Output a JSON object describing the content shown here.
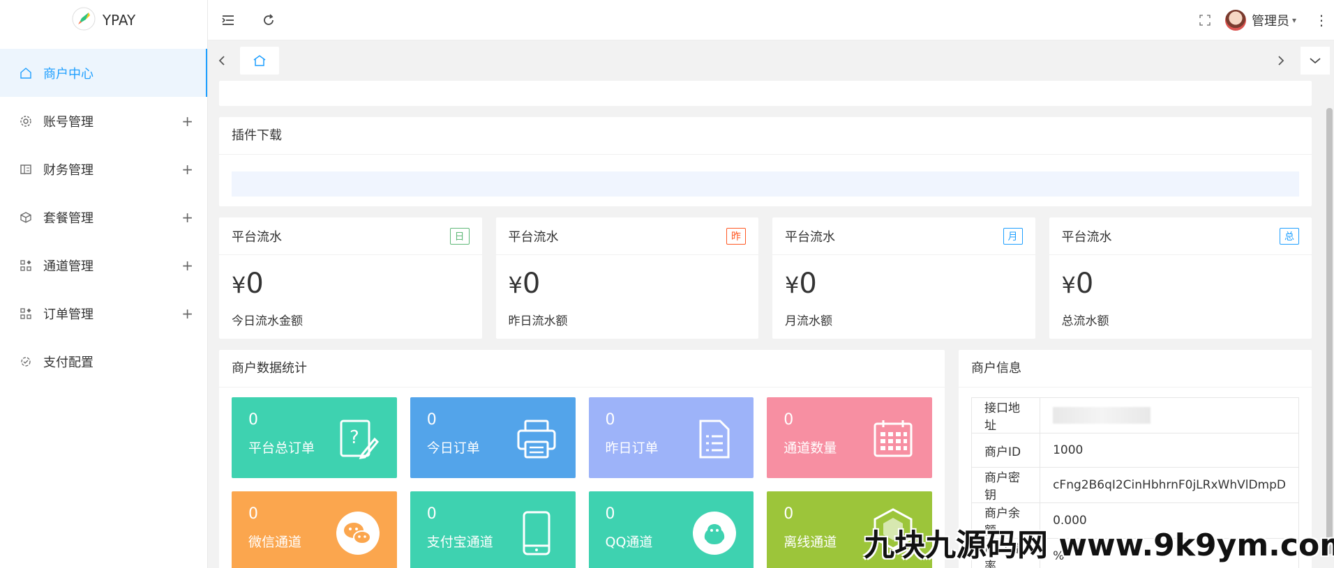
{
  "app": {
    "logo_text": "YPAY"
  },
  "sidebar": {
    "items": [
      {
        "label": "商户中心",
        "icon": "home-icon",
        "active": true,
        "expandable": false
      },
      {
        "label": "账号管理",
        "icon": "gear-icon",
        "expandable": true
      },
      {
        "label": "财务管理",
        "icon": "ledger-icon",
        "expandable": true
      },
      {
        "label": "套餐管理",
        "icon": "cube-icon",
        "expandable": true
      },
      {
        "label": "通道管理",
        "icon": "apps-icon",
        "expandable": true
      },
      {
        "label": "订单管理",
        "icon": "apps-icon",
        "expandable": true
      },
      {
        "label": "支付配置",
        "icon": "config-icon",
        "expandable": false
      }
    ],
    "plus": "+"
  },
  "header": {
    "admin_name": "管理员",
    "caret": "▾",
    "menu": "⋮"
  },
  "plugin": {
    "title": "插件下载"
  },
  "stats": [
    {
      "title": "平台流水",
      "tag": "日",
      "tag_color": "#5fb878",
      "currency": "¥",
      "value": "0",
      "desc": "今日流水金额"
    },
    {
      "title": "平台流水",
      "tag": "昨",
      "tag_color": "#ff5722",
      "currency": "¥",
      "value": "0",
      "desc": "昨日流水额"
    },
    {
      "title": "平台流水",
      "tag": "月",
      "tag_color": "#1e9fff",
      "currency": "¥",
      "value": "0",
      "desc": "月流水额"
    },
    {
      "title": "平台流水",
      "tag": "总",
      "tag_color": "#1e9fff",
      "currency": "¥",
      "value": "0",
      "desc": "总流水额"
    }
  ],
  "merchant_stats": {
    "title": "商户数据统计",
    "tiles": [
      {
        "count": "0",
        "label": "平台总订单",
        "color": "#3ed2b0",
        "icon": "edit-doc-icon"
      },
      {
        "count": "0",
        "label": "今日订单",
        "color": "#53a4ea",
        "icon": "printer-icon"
      },
      {
        "count": "0",
        "label": "昨日订单",
        "color": "#9db3f9",
        "icon": "document-icon"
      },
      {
        "count": "0",
        "label": "通道数量",
        "color": "#f78fa2",
        "icon": "calendar-icon"
      },
      {
        "count": "0",
        "label": "微信通道",
        "color": "#fba64e",
        "icon": "wechat-icon"
      },
      {
        "count": "0",
        "label": "支付宝通道",
        "color": "#3ed2b0",
        "icon": "phone-icon"
      },
      {
        "count": "0",
        "label": "QQ通道",
        "color": "#3ed2b0",
        "icon": "qq-icon"
      },
      {
        "count": "0",
        "label": "离线通道",
        "color": "#9cc53a",
        "icon": "hexagon-icon"
      }
    ]
  },
  "merchant_info": {
    "title": "商户信息",
    "rows": [
      {
        "key": "接口地址",
        "value": "",
        "blurred": true
      },
      {
        "key": "商户ID",
        "value": "1000"
      },
      {
        "key": "商户密钥",
        "value": "cFng2B6qI2CinHbhrnF0jLRxWhVlDmpD"
      },
      {
        "key": "商户余额",
        "value": "0.000"
      },
      {
        "key": "商户费率",
        "value": "%"
      }
    ]
  },
  "watermark": "九块九源码网 www.9k9ym.com"
}
